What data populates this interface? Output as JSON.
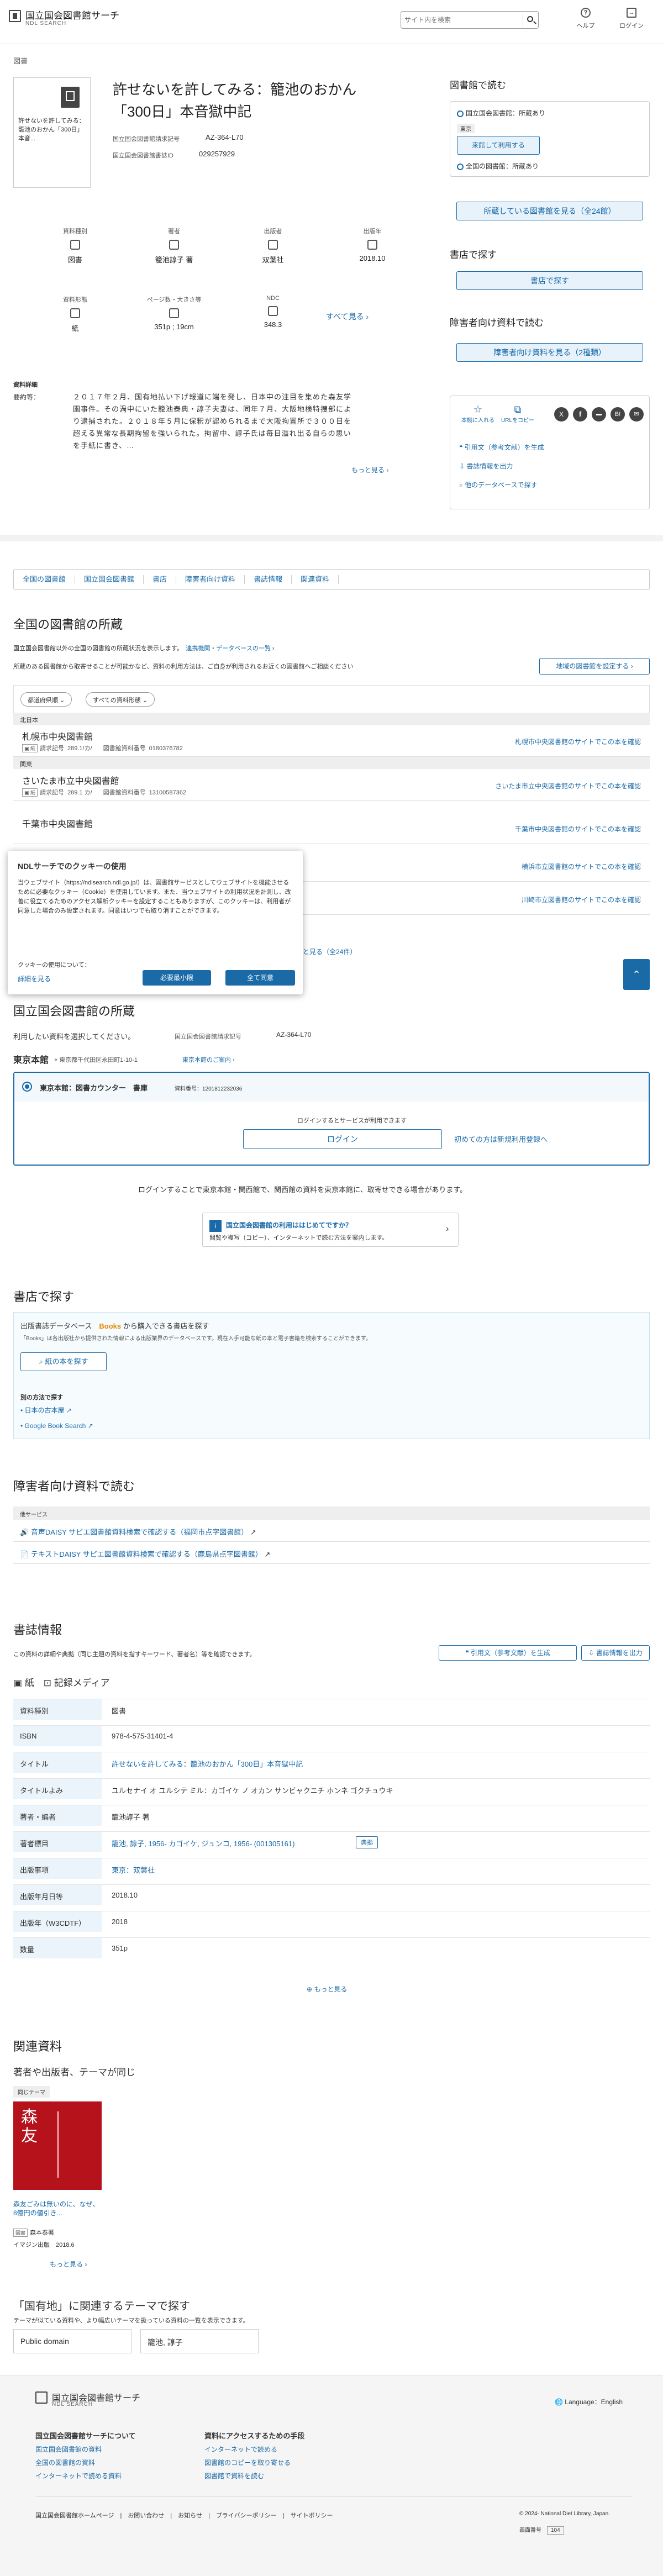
{
  "header": {
    "logo_title": "国立国会図書館サーチ",
    "logo_sub": "NDL SEARCH",
    "search_placeholder": "サイト内を検索",
    "help": "ヘルプ",
    "login": "ログイン"
  },
  "breadcrumb": "図書",
  "book": {
    "title_line1": "許せないを許してみる：籠池のおかん",
    "title_line2": "「300日」本音獄中記",
    "thumb_text": "許せないを許してみる：籠池のおかん「300日」本音...",
    "callno_label": "国立国会図書館請求記号",
    "callno": "AZ-364-L70",
    "bibid_label": "国立国会図書館書誌ID",
    "bibid": "029257929"
  },
  "facets": [
    {
      "label": "資料種別",
      "value": "図書"
    },
    {
      "label": "著者",
      "value": "籠池諄子 著"
    },
    {
      "label": "出版者",
      "value": "双葉社"
    },
    {
      "label": "出版年",
      "value": "2018.10"
    },
    {
      "label": "資料形態",
      "value": "紙"
    },
    {
      "label": "ページ数・大きさ等",
      "value": "351p ; 19cm"
    },
    {
      "label": "NDC",
      "value": "348.3"
    }
  ],
  "see_all": "すべて見る",
  "detail": {
    "heading": "資料詳細",
    "label": "要約等：",
    "text1": "２０１７年２月、国有地払い下げ報道に端を発し、日本中の注目を集めた森友学",
    "text2": "園事件。その渦中にいた籠池泰典・諄子夫妻は、同年７月、大阪地検特捜部によ",
    "text3": "り逮捕された。２０１８年５月に保釈が認められるまで大阪拘置所で３００日を",
    "text4": "超える異常な長期拘留を強いられた。拘留中、諄子氏は毎日溢れ出る自らの思い",
    "text5": "を手紙に書き、…",
    "more": "もっと見る"
  },
  "side": {
    "read_title": "図書館で読む",
    "ndl_has": "国立国会図書館：所蔵あり",
    "tokyo": "東京",
    "visit": "来館して利用する",
    "all_has": "全国の図書館：所蔵あり",
    "all_btn": "所蔵している図書館を見る（全24館）",
    "buy_title": "書店で探す",
    "buy_btn": "書店で探す",
    "dis_title": "障害者向け資料で読む",
    "dis_btn": "障害者向け資料を見る（2種類）",
    "share1": "本棚に入れる",
    "share2": "URLをコピー",
    "link1": "引用文（参考文献）を生成",
    "link2": "書誌情報を出力",
    "link3": "他のデータベースで探す"
  },
  "tabs": [
    "全国の図書館",
    "国立国会図書館",
    "書店",
    "障害者向け資料",
    "書誌情報",
    "関連資料"
  ],
  "national": {
    "title": "全国の図書館の所蔵",
    "desc1": "国立国会図書館以外の全国の図書館の所蔵状況を表示します。",
    "link": "連携機関・データベースの一覧",
    "desc2": "所蔵のある図書館から取寄せることが可能かなど、資料の利用方法は、ご自身が利用されるお近くの図書館へご相談ください",
    "set_btn": "地域の図書館を設定する",
    "sel1": "都道府県順",
    "sel2": "すべての資料形態",
    "regions": [
      "北日本",
      "関東"
    ],
    "libs": [
      {
        "name": "札幌市中央図書館",
        "callno": "289.1/カ/",
        "holdno": "0180376782",
        "link": "札幌市中央図書館のサイトでこの本を確認"
      },
      {
        "name": "さいたま市立中央図書館",
        "callno": "289.1 カ/",
        "holdno": "13100587362",
        "link": "さいたま市立中央図書館のサイトでこの本を確認"
      },
      {
        "name": "千葉市中央図書館",
        "callno": "",
        "holdno": "",
        "link": "千葉市中央図書館のサイトでこの本を確認"
      },
      {
        "name": "",
        "callno": "",
        "holdno": "",
        "link": "横浜市立図書館のサイトでこの本を確認"
      },
      {
        "name": "",
        "callno": "",
        "holdno": "",
        "link": "川崎市立図書館のサイトでこの本を確認"
      }
    ],
    "callno_l": "請求記号",
    "holdno_l": "図書館資料番号",
    "more": "もっと見る（全24件）"
  },
  "cookie": {
    "title": "NDLサーチでのクッキーの使用",
    "body1": "当ウェブサイト（https://ndlsearch.ndl.go.jp/）は、図書館サービスとしてウェブサイトを機能させるために必要なクッキー（Cookie）を使用しています。また、当ウェブサイトの利用状況を計測し、改善に役立てるためのアクセス解析クッキーを設定することもありますが、このクッキーは、利用者が同意した場合のみ設定されます。同意はいつでも取り消すことができます。",
    "body2": "クッキーの使用について：",
    "detail": "詳細を見る",
    "need": "必要最小限",
    "all": "全て同意"
  },
  "ndl": {
    "title": "国立国会図書館の所蔵",
    "select": "利用したい資料を選択してください。",
    "callno_label": "国立国会図書館請求記号",
    "callno": "AZ-364-L70",
    "branch": "東京本館",
    "addr": "東京都千代田区永田町1-10-1",
    "guide": "東京本館のご案内",
    "counter": "東京本館：図書カウンター　書庫",
    "reqno": "資料番号：1201812232036",
    "login_msg": "ログインするとサービスが利用できます",
    "login_btn": "ログイン",
    "register": "初めての方は新規利用登録へ",
    "note": "ログインすることで東京本館・関西館で、関西館の資料を東京本館に、取寄せできる場合があります。",
    "guide_title": "国立国会図書館の利用ははじめてですか？",
    "guide_sub": "閲覧や複写（コピー）、インターネットで読む方法を案内します。"
  },
  "shop": {
    "title": "書店で探す",
    "line": "出版書誌データベース",
    "books": "Books",
    "line2": "から購入できる書店を探す",
    "desc": "「Books」は各出版社から提供された情報による出版業界のデータベースです。現在入手可能な紙の本と電子書籍を検索することができます。",
    "btn": "紙の本を探す",
    "other": "別の方法で探す",
    "l1": "日本の古本屋",
    "l2": "Google Book Search"
  },
  "dis": {
    "title": "障害者向け資料で読む",
    "sub": "他サービス",
    "l1": "音声DAISY サピエ図書館資料検索で確認する（福岡市点字図書館）",
    "l2": "テキストDAISY サピエ図書館資料検索で確認する（鹿島県点字図書館）"
  },
  "biblio": {
    "title": "書誌情報",
    "desc": "この資料の詳細や典拠（同じ主題の資料を指すキーワード、著者名）等を確認できます。",
    "b1": "引用文（参考文献）を生成",
    "b2": "書誌情報を出力",
    "media": "紙",
    "media2": "記録メディア",
    "rows": [
      {
        "k": "資料種別",
        "v": "図書"
      },
      {
        "k": "ISBN",
        "v": "978-4-575-31401-4"
      },
      {
        "k": "タイトル",
        "v": "許せないを許してみる：籠池のおかん「300日」本音獄中記"
      },
      {
        "k": "タイトルよみ",
        "v": "ユルセナイ オ ユルシテ ミル：カゴイケ ノ オカン サンビャクニチ ホンネ ゴクチュウキ"
      },
      {
        "k": "著者・編者",
        "v": "籠池諄子 著"
      },
      {
        "k": "著者標目",
        "v": "籠池, 諄子, 1956- カゴイケ, ジュンコ, 1956- (001305161)"
      },
      {
        "k": "出版事項",
        "v": "東京：双葉社"
      },
      {
        "k": "出版年月日等",
        "v": "2018.10"
      },
      {
        "k": "出版年（W3CDTF）",
        "v": "2018"
      },
      {
        "k": "数量",
        "v": "351p"
      }
    ],
    "more": "もっと見る",
    "tenkyo": "典拠"
  },
  "related": {
    "title": "関連資料",
    "sub": "著者や出版者、テーマが同じ",
    "tag": "同じテーマ",
    "book_title": "森友ごみは無いのに、なぜ、8億円の値引き...",
    "book_label": "図書",
    "book_author": "森本泰著",
    "book_pub": "イマジン出版",
    "book_date": "2018.6",
    "more": "もっと見る"
  },
  "theme": {
    "title": "「国有地」に関連するテーマで探す",
    "desc": "テーマが似ている資料や、より幅広いテーマを扱っている資料の一覧を表示できます。",
    "t1": "Public domain",
    "t2": "籠池, 諄子"
  },
  "footer": {
    "logo_title": "国立国会図書館サーチ",
    "logo_sub": "NDL SEARCH",
    "lang": "Language：English",
    "c1": "国立国会図書館サーチについて",
    "c1a": "国立国会図書館の資料",
    "c1b": "全国の図書館の資料",
    "c1c": "インターネットで読める資料",
    "c2": "資料にアクセスするための手段",
    "c2a": "インターネットで読める",
    "c2b": "図書館のコピーを取り寄せる",
    "c2c": "図書館で資料を読む",
    "n1": "国立国会図書館ホームページ",
    "n2": "お問い合わせ",
    "n3": "お知らせ",
    "n4": "プライバシーポリシー",
    "n5": "サイトポリシー",
    "copy": "© 2024- National Diet Library, Japan.",
    "counter_label": "画面番号",
    "counter": "104"
  }
}
